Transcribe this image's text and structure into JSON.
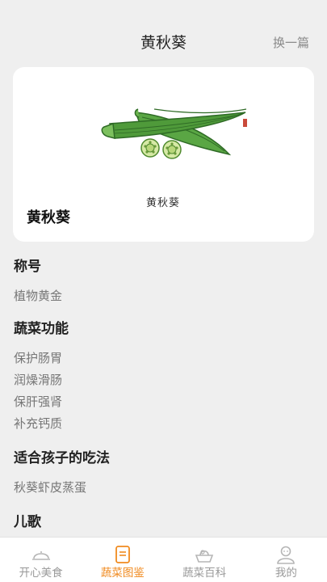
{
  "header": {
    "title": "黄秋葵",
    "action_label": "换一篇"
  },
  "card": {
    "name": "黄秋葵",
    "caption": "黄秋葵",
    "illustration_icon": "okra-illustration"
  },
  "sections": [
    {
      "title": "称号",
      "items": [
        "植物黄金"
      ]
    },
    {
      "title": "蔬菜功能",
      "items": [
        "保护肠胃",
        "润燥滑肠",
        "保肝强肾",
        "补充钙质"
      ]
    },
    {
      "title": "适合孩子的吃法",
      "items": [
        "秋葵虾皮蒸蛋"
      ]
    },
    {
      "title": "儿歌",
      "items": []
    }
  ],
  "bottom_nav": {
    "items": [
      {
        "label": "开心美食",
        "icon": "food-cover-icon",
        "active": false
      },
      {
        "label": "蔬菜图鉴",
        "icon": "book-icon",
        "active": true
      },
      {
        "label": "蔬菜百科",
        "icon": "basket-icon",
        "active": false
      },
      {
        "label": "我的",
        "icon": "user-icon",
        "active": false
      }
    ]
  },
  "colors": {
    "accent": "#f08a1f",
    "background": "#efefef",
    "okra_green": "#4f9a3a"
  }
}
